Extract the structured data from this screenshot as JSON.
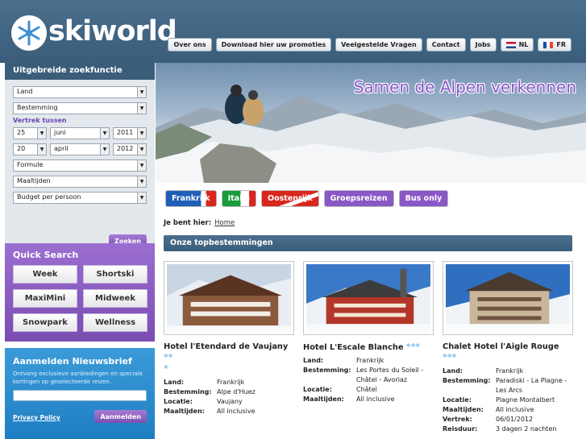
{
  "brand": {
    "name": "skiworld"
  },
  "topnav": [
    {
      "label": "Over ons"
    },
    {
      "label": "Download hier uw promoties"
    },
    {
      "label": "Veelgestelde Vragen"
    },
    {
      "label": "Contact"
    },
    {
      "label": "Jobs"
    },
    {
      "label": "NL"
    },
    {
      "label": "FR"
    }
  ],
  "search": {
    "title": "Uitgebreide zoekfunctie",
    "land": "Land",
    "bestemming": "Bestemming",
    "vertrek_label": "Vertrek tussen",
    "from": {
      "day": "25",
      "month": "juni",
      "year": "2011"
    },
    "to": {
      "day": "20",
      "month": "april",
      "year": "2012"
    },
    "formule": "Formule",
    "maaltijden": "Maaltijden",
    "budget": "Budget per persoon",
    "submit": "Zoeken"
  },
  "quick": {
    "title": "Quick Search",
    "buttons": [
      "Week",
      "Shortski",
      "MaxiMini",
      "Midweek",
      "Snowpark",
      "Wellness"
    ]
  },
  "newsletter": {
    "title": "Aanmelden Nieuwsbrief",
    "text": "Ontvang exclusieve aanbiedingen en speciale kortingen op geselecteerde reizen.",
    "privacy": "Privacy Policy",
    "submit": "Aanmelden"
  },
  "banner": {
    "tagline": "Samen de Alpen verkennen"
  },
  "country_tabs": [
    {
      "label": "Frankrijk",
      "colors": [
        "#1f5fb8",
        "#ffffff",
        "#d9271e"
      ]
    },
    {
      "label": "Italië",
      "colors": [
        "#1a9c3a",
        "#ffffff",
        "#d9271e"
      ]
    },
    {
      "label": "Oostenrijk",
      "colors": [
        "#d9271e",
        "#ffffff",
        "#d9271e"
      ]
    },
    {
      "label": "Groepsreizen",
      "colors": [
        "#8a57c7",
        "#8a57c7",
        "#8a57c7"
      ]
    },
    {
      "label": "Bus only",
      "colors": [
        "#8a57c7",
        "#8a57c7",
        "#8a57c7"
      ]
    }
  ],
  "breadcrumb": {
    "label": "Je bent hier:",
    "home": "Home"
  },
  "section_title": "Onze topbestemmingen",
  "hotels": [
    {
      "name": "Hotel l'Etendard de Vaujany",
      "stars": "**\n*",
      "rows": [
        {
          "k": "Land:",
          "v": "Frankrijk"
        },
        {
          "k": "Bestemming:",
          "v": "Alpe d'Huez"
        },
        {
          "k": "Locatie:",
          "v": "Vaujany"
        },
        {
          "k": "Maaltijden:",
          "v": "All inclusive"
        }
      ]
    },
    {
      "name": "Hotel L'Escale Blanche",
      "stars": "***",
      "rows": [
        {
          "k": "Land:",
          "v": "Frankrijk"
        },
        {
          "k": "Bestemming:",
          "v": "Les Portes du Soleil - Châtel - Avoriaz"
        },
        {
          "k": "Locatie:",
          "v": "Châtel"
        },
        {
          "k": "Maaltijden:",
          "v": "All inclusive"
        }
      ]
    },
    {
      "name": "Chalet Hotel l'Aigle Rouge",
      "stars": "***",
      "rows": [
        {
          "k": "Land:",
          "v": "Frankrijk"
        },
        {
          "k": "Bestemming:",
          "v": "Paradiski - La Plagne - Les Arcs"
        },
        {
          "k": "Locatie:",
          "v": "Plagne Montalbert"
        },
        {
          "k": "Maaltijden:",
          "v": "All inclusive"
        },
        {
          "k": "Vertrek:",
          "v": "06/01/2012"
        },
        {
          "k": "Reisduur:",
          "v": "3 dagen 2 nachten"
        }
      ]
    }
  ]
}
